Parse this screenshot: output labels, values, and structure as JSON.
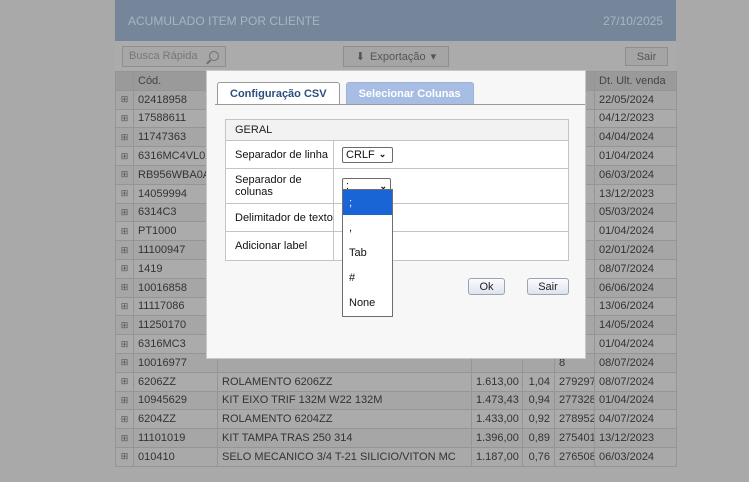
{
  "app": {
    "title": "ACUMULADO ITEM POR CLIENTE",
    "date": "27/10/2025",
    "search_placeholder": "Busca Rápida",
    "export_label": "Exportação",
    "exit_label": "Sair"
  },
  "grid": {
    "headers": [
      "Cód.",
      "",
      "",
      "",
      "ed.",
      "Dt. Ult. venda"
    ],
    "rows": [
      [
        "02418958",
        "",
        "",
        "",
        "0",
        "22/05/2024"
      ],
      [
        "17588611",
        "",
        "",
        "",
        "7",
        "04/12/2023"
      ],
      [
        "11747363",
        "",
        "",
        "",
        "2",
        "04/04/2024"
      ],
      [
        "6316MC4VL02",
        "",
        "",
        "",
        "3",
        "01/04/2024"
      ],
      [
        "RB956WBA0AE",
        "",
        "",
        "",
        "8",
        "06/03/2024"
      ],
      [
        "14059994",
        "",
        "",
        "",
        "1",
        "13/12/2023"
      ],
      [
        "6314C3",
        "",
        "",
        "",
        "7",
        "05/03/2024"
      ],
      [
        "PT1000",
        "",
        "",
        "",
        "3",
        "01/04/2024"
      ],
      [
        "11100947",
        "",
        "",
        "",
        "5",
        "02/01/2024"
      ],
      [
        "1419",
        "",
        "",
        "",
        "7",
        "08/07/2024"
      ],
      [
        "10016858",
        "",
        "",
        "",
        "9",
        "06/06/2024"
      ],
      [
        "11117086",
        "",
        "",
        "",
        "1",
        "13/06/2024"
      ],
      [
        "11250170",
        "",
        "",
        "",
        "3",
        "14/05/2024"
      ],
      [
        "6316MC3",
        "",
        "",
        "",
        "3",
        "01/04/2024"
      ],
      [
        "10016977",
        "",
        "",
        "",
        "8",
        "08/07/2024"
      ],
      [
        "6206ZZ",
        "ROLAMENTO 6206ZZ",
        "1.613,00",
        "1,04",
        "279297",
        "08/07/2024"
      ],
      [
        "10945629",
        "KIT EIXO TRIF 132M W22 132M",
        "1.473,43",
        "0,94",
        "277328",
        "01/04/2024"
      ],
      [
        "6204ZZ",
        "ROLAMENTO 6204ZZ",
        "1.433,00",
        "0,92",
        "278952",
        "04/07/2024"
      ],
      [
        "11101019",
        "KIT TAMPA TRAS 250 314",
        "1.396,00",
        "0,89",
        "275401",
        "13/12/2023"
      ],
      [
        "010410",
        "SELO MECANICO 3/4 T-21 SILICIO/VITON MC",
        "1.187,00",
        "0,76",
        "276508",
        "06/03/2024"
      ]
    ]
  },
  "dialog": {
    "tabs": [
      "Configuração CSV",
      "Selecionar Colunas"
    ],
    "section_title": "GERAL",
    "fields": {
      "line_separator_label": "Separador de linha",
      "line_separator_value": "CRLF",
      "col_separator_label_1": "Separador de",
      "col_separator_label_2": "colunas",
      "col_separator_value": ";",
      "text_delimiter_label": "Delimitador de texto",
      "add_label_label": "Adicionar label"
    },
    "dropdown_options": [
      ";",
      ",",
      "Tab",
      "#",
      "None"
    ],
    "ok_label": "Ok",
    "exit_label": "Sair"
  }
}
